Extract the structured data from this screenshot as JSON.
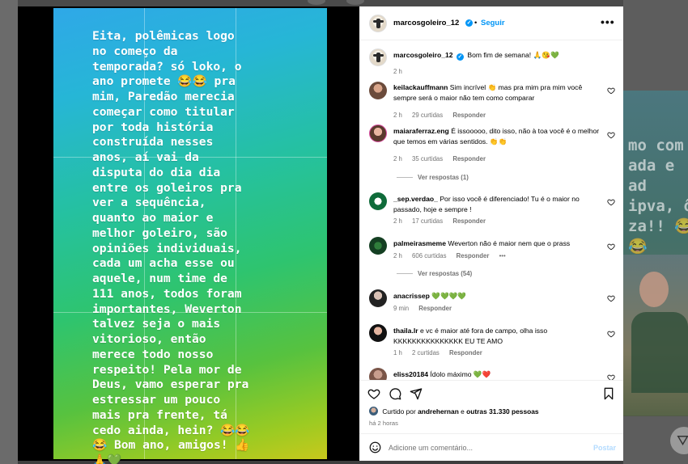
{
  "story": {
    "text": "Eita, polêmicas logo no começo da temporada? só loko, o ano promete 😂😂 pra mim, Paredão merecia começar como titular por toda história construída nesses anos, aí vai da disputa do dia dia entre os goleiros pra ver a sequência, quanto ao maior e melhor goleiro, são opiniões individuais, cada um acha esse ou aquele, num time de 111 anos, todos foram importantes, Weverton talvez seja o mais vitorioso, então merece todo nosso respeito! Pela mor de Deus, vamo esperar pra estressar um pouco mais pra frente, tá cedo ainda, hein? 😂😂 😂 Bom ano, amigos! 👍 🙏💚"
  },
  "header": {
    "username": "marcosgoleiro_12",
    "separator": "•",
    "follow_label": "Seguir",
    "more_label": "•••"
  },
  "caption": {
    "username": "marcosgoleiro_12",
    "text": "Bom fim de semana! 🙏😘💚",
    "time": "2 h"
  },
  "comments": [
    {
      "username": "keilackauffmann",
      "text": "Sim incrível 👏 mas pra mim pra mim você sempre será o maior não tem como comparar",
      "time": "2 h",
      "likes": "29 curtidas",
      "reply": "Responder"
    },
    {
      "username": "maiaraferraz.eng",
      "text": "É issooooo, dito isso, não à toa você é o melhor que temos em várias sentidos. 👏👏",
      "time": "2 h",
      "likes": "35 curtidas",
      "reply": "Responder",
      "view_replies": "Ver respostas (1)"
    },
    {
      "username": "_sep.verdao_",
      "text": "Por isso você é diferenciado! Tu é o maior no passado, hoje e sempre !",
      "time": "2 h",
      "likes": "17 curtidas",
      "reply": "Responder"
    },
    {
      "username": "palmeirasmeme",
      "text": "Weverton não é maior nem que o prass",
      "time": "2 h",
      "likes": "606 curtidas",
      "reply": "Responder",
      "more": "•••",
      "view_replies": "Ver respostas (54)"
    },
    {
      "username": "anacrissep",
      "text": "💚💚💚💚",
      "time": "9 min",
      "reply": "Responder"
    },
    {
      "username": "thaila.lr",
      "text": "e vc é maior até fora de campo, olha isso KKKKKKKKKKKKKKK EU TE AMO",
      "time": "1 h",
      "likes": "2 curtidas",
      "reply": "Responder"
    },
    {
      "username": "eliss20184",
      "text": "Ídolo máximo 💚❤️"
    }
  ],
  "actions": {
    "liked_by_prefix": "Curtido por",
    "liked_by_user": "andrehernan",
    "liked_by_connector": "e",
    "liked_by_others": "outras 31.330 pessoas",
    "time_ago": "há 2 horas"
  },
  "comment_box": {
    "placeholder": "Adicione um comentário...",
    "post_label": "Postar"
  },
  "background": {
    "right_text": "mo com ada e ad ipva, ô za!! 😂😂",
    "filter_icon": "filter-icon"
  }
}
